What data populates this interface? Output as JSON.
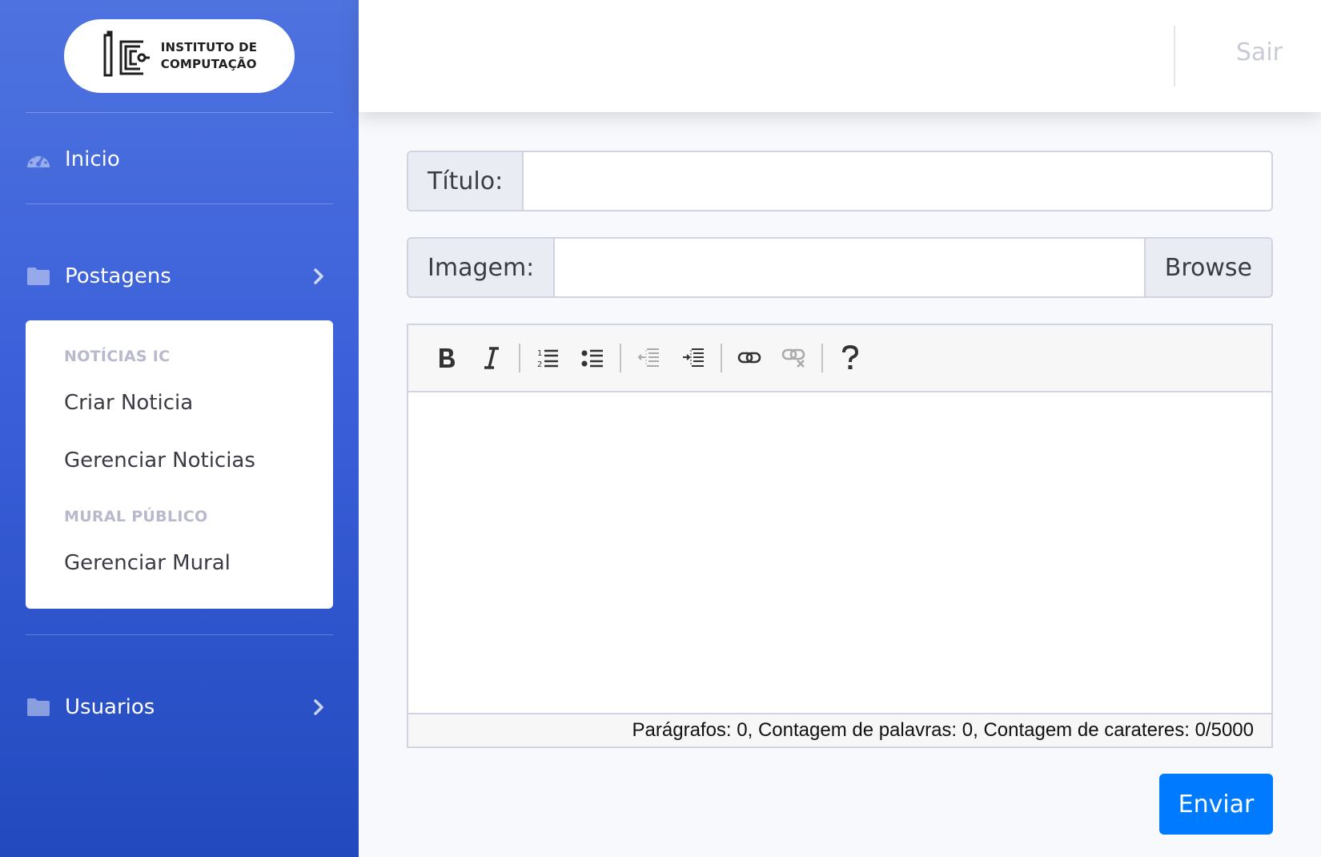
{
  "sidebar": {
    "brand": {
      "line1": "INSTITUTO DE",
      "line2": "COMPUTAÇÃO",
      "logo_icon": "ic-logo"
    },
    "items": [
      {
        "label": "Inicio",
        "icon": "dashboard-icon"
      },
      {
        "label": "Postagens",
        "icon": "folder-icon",
        "expanded": true
      },
      {
        "label": "Usuarios",
        "icon": "folder-icon",
        "expanded": false
      }
    ],
    "collapse": {
      "header_news": "NOTÍCIAS IC",
      "item_create": "Criar Noticia",
      "item_manage": "Gerenciar Noticias",
      "header_mural": "MURAL PÚBLICO",
      "item_mural": "Gerenciar Mural"
    }
  },
  "topbar": {
    "logout_label": "Sair"
  },
  "form": {
    "title_label": "Título:",
    "title_value": "",
    "image_label": "Imagem:",
    "image_value": "",
    "browse_label": "Browse",
    "editor": {
      "toolbar": [
        "bold",
        "italic",
        "ordered-list",
        "unordered-list",
        "outdent",
        "indent",
        "link",
        "unlink",
        "help"
      ],
      "status": "Parágrafos: 0, Contagem de palavras: 0, Contagem de carateres: 0/5000"
    },
    "submit_label": "Enviar"
  },
  "colors": {
    "sidebar_top": "#4e73df",
    "sidebar_bottom": "#224abe",
    "primary_button": "#007bff"
  }
}
